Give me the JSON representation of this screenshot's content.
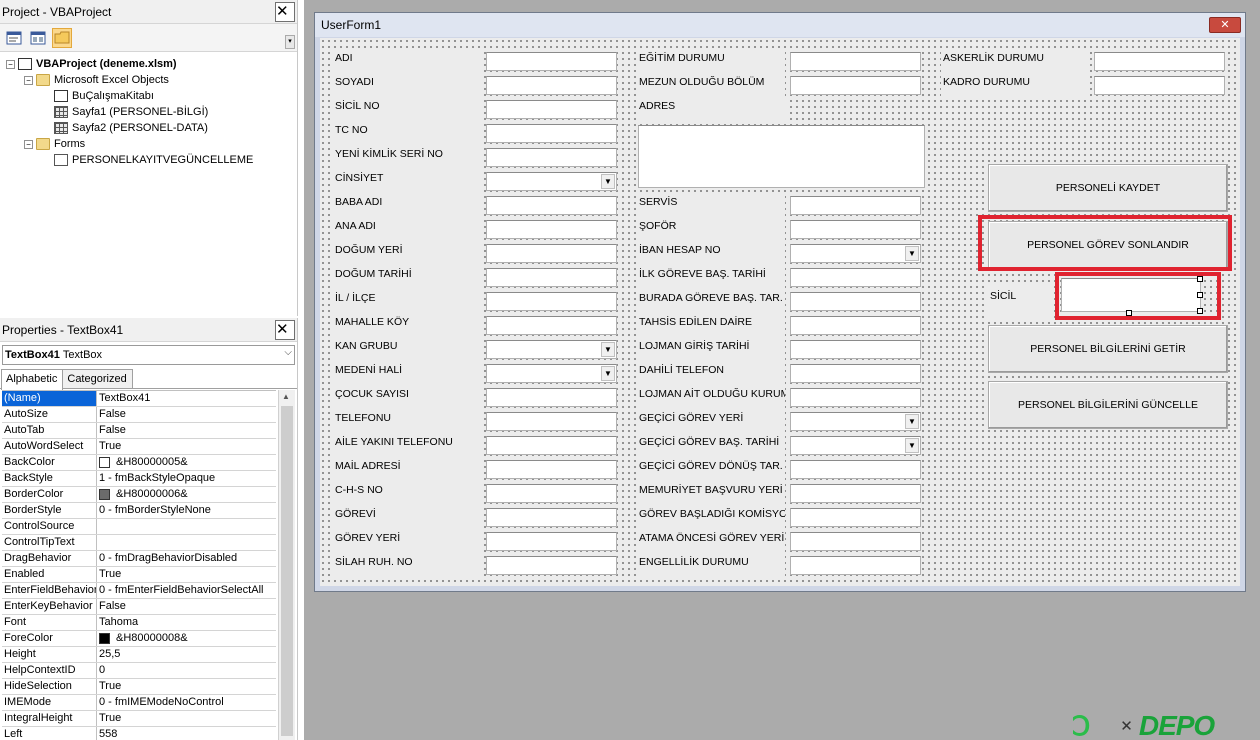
{
  "project": {
    "title": "Project - VBAProject",
    "tree": [
      {
        "label": "VBAProject (deneme.xlsm)",
        "level": 0,
        "icon": "vbaproject-icon",
        "bold": true,
        "exp": "−"
      },
      {
        "label": "Microsoft Excel Objects",
        "level": 1,
        "icon": "folder-icon",
        "exp": "−"
      },
      {
        "label": "BuÇalışmaKitabı",
        "level": 2,
        "icon": "workbook-icon"
      },
      {
        "label": "Sayfa1 (PERSONEL-BİLGİ)",
        "level": 2,
        "icon": "worksheet-icon"
      },
      {
        "label": "Sayfa2 (PERSONEL-DATA)",
        "level": 2,
        "icon": "worksheet-icon"
      },
      {
        "label": "Forms",
        "level": 1,
        "icon": "folder-icon",
        "exp": "−"
      },
      {
        "label": "PERSONELKAYITVEGÜNCELLEME",
        "level": 2,
        "icon": "userform-icon"
      }
    ]
  },
  "properties": {
    "title": "Properties - TextBox41",
    "object_name": "TextBox41",
    "object_type": "TextBox",
    "tabs": [
      "Alphabetic",
      "Categorized"
    ],
    "rows": [
      {
        "name": "(Name)",
        "value": "TextBox41",
        "selected": true
      },
      {
        "name": "AutoSize",
        "value": "False"
      },
      {
        "name": "AutoTab",
        "value": "False"
      },
      {
        "name": "AutoWordSelect",
        "value": "True"
      },
      {
        "name": "BackColor",
        "value": "&H80000005&",
        "swatch": "#ffffff"
      },
      {
        "name": "BackStyle",
        "value": "1 - fmBackStyleOpaque"
      },
      {
        "name": "BorderColor",
        "value": "&H80000006&",
        "swatch": "#6b6b6b"
      },
      {
        "name": "BorderStyle",
        "value": "0 - fmBorderStyleNone"
      },
      {
        "name": "ControlSource",
        "value": ""
      },
      {
        "name": "ControlTipText",
        "value": ""
      },
      {
        "name": "DragBehavior",
        "value": "0 - fmDragBehaviorDisabled"
      },
      {
        "name": "Enabled",
        "value": "True"
      },
      {
        "name": "EnterFieldBehavior",
        "value": "0 - fmEnterFieldBehaviorSelectAll"
      },
      {
        "name": "EnterKeyBehavior",
        "value": "False"
      },
      {
        "name": "Font",
        "value": "Tahoma"
      },
      {
        "name": "ForeColor",
        "value": "&H80000008&",
        "swatch": "#000000"
      },
      {
        "name": "Height",
        "value": "25,5"
      },
      {
        "name": "HelpContextID",
        "value": "0"
      },
      {
        "name": "HideSelection",
        "value": "True"
      },
      {
        "name": "IMEMode",
        "value": "0 - fmIMEModeNoControl"
      },
      {
        "name": "IntegralHeight",
        "value": "True"
      },
      {
        "name": "Left",
        "value": "558"
      }
    ]
  },
  "userform": {
    "title": "UserForm1",
    "close_glyph": "✕",
    "col1": [
      {
        "label": "ADI"
      },
      {
        "label": "SOYADI"
      },
      {
        "label": "SİCİL NO"
      },
      {
        "label": "TC NO"
      },
      {
        "label": "YENİ KİMLİK SERİ NO"
      },
      {
        "label": "CİNSİYET",
        "combo": true
      },
      {
        "label": "BABA ADI"
      },
      {
        "label": "ANA ADI"
      },
      {
        "label": "DOĞUM YERİ"
      },
      {
        "label": "DOĞUM TARİHİ"
      },
      {
        "label": "İL / İLÇE"
      },
      {
        "label": "MAHALLE KÖY"
      },
      {
        "label": "KAN GRUBU",
        "combo": true
      },
      {
        "label": "MEDENİ HALİ",
        "combo": true
      },
      {
        "label": "ÇOCUK SAYISI"
      },
      {
        "label": "TELEFONU"
      },
      {
        "label": "AİLE YAKINI TELEFONU"
      },
      {
        "label": "MAİL ADRESİ"
      },
      {
        "label": "C-H-S NO"
      },
      {
        "label": "GÖREVİ"
      },
      {
        "label": "GÖREV YERİ"
      },
      {
        "label": "SİLAH RUH. NO"
      }
    ],
    "col2_top": [
      {
        "label": "EĞİTİM DURUMU"
      },
      {
        "label": "MEZUN OLDUĞU BÖLÜM"
      }
    ],
    "address_label": "ADRES",
    "col2": [
      {
        "label": "SERVİS"
      },
      {
        "label": "ŞOFÖR"
      },
      {
        "label": "İBAN HESAP NO",
        "combo": true
      },
      {
        "label": "İLK GÖREVE BAŞ. TARİHİ"
      },
      {
        "label": "BURADA GÖREVE BAŞ. TAR."
      },
      {
        "label": "TAHSİS EDİLEN DAİRE"
      },
      {
        "label": "LOJMAN GİRİŞ TARİHİ"
      },
      {
        "label": "DAHİLİ TELEFON"
      },
      {
        "label": "LOJMAN AİT OLDUĞU KURUM"
      },
      {
        "label": "GEÇİCİ GÖREV YERİ",
        "combo": true
      },
      {
        "label": "GEÇİCİ GÖREV BAŞ. TARİHİ",
        "combo": true
      },
      {
        "label": "GEÇİCİ GÖREV DÖNÜŞ TAR."
      },
      {
        "label": "MEMURİYET BAŞVURU YERİ"
      },
      {
        "label": "GÖREV BAŞLADIĞI KOMİSYON"
      },
      {
        "label": "ATAMA ÖNCESİ GÖREV YERİ"
      },
      {
        "label": "ENGELLİLİK DURUMU"
      }
    ],
    "col3": [
      {
        "label": "ASKERLİK DURUMU"
      },
      {
        "label": "KADRO DURUMU"
      }
    ],
    "buttons": {
      "save": "PERSONELİ KAYDET",
      "terminate": "PERSONEL GÖREV SONLANDIR",
      "fetch": "PERSONEL BİLGİLERİNİ GETİR",
      "update": "PERSONEL BİLGİLERİNİ GÜNCELLE"
    },
    "sicil_label": "SİCİL",
    "highlight_color": "#e02330"
  },
  "watermark": {
    "x_glyph": "✕",
    "c_glyph": "Ↄ",
    "brand": "DEPO"
  }
}
